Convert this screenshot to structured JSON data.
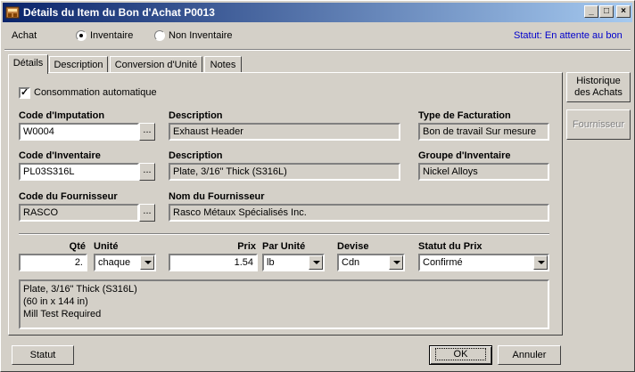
{
  "window": {
    "title": "Détails du Item du Bon d'Achat P0013",
    "minimize_glyph": "_",
    "maximize_glyph": "□",
    "close_glyph": "×"
  },
  "header": {
    "achat_label": "Achat",
    "radio_inventaire": "Inventaire",
    "radio_non_inventaire": "Non Inventaire",
    "selected": "Inventaire",
    "status": "Statut: En attente au bon"
  },
  "tabs": [
    {
      "label": "Détails",
      "active": true
    },
    {
      "label": "Description",
      "active": false
    },
    {
      "label": "Conversion d'Unité",
      "active": false
    },
    {
      "label": "Notes",
      "active": false
    }
  ],
  "details": {
    "auto_consumption_label": "Consommation automatique",
    "auto_consumption_checked": true,
    "code_imputation_label": "Code d'Imputation",
    "code_imputation_value": "W0004",
    "desc1_label": "Description",
    "desc1_value": "Exhaust Header",
    "type_fact_label": "Type de Facturation",
    "type_fact_value": "Bon de travail Sur mesure",
    "code_inventaire_label": "Code d'Inventaire",
    "code_inventaire_value": "PL03S316L",
    "desc2_label": "Description",
    "desc2_value": "Plate, 3/16\" Thick (S316L)",
    "groupe_inv_label": "Groupe d'Inventaire",
    "groupe_inv_value": "Nickel Alloys",
    "code_fourn_label": "Code du Fournisseur",
    "code_fourn_value": "RASCO",
    "nom_fourn_label": "Nom du Fournisseur",
    "nom_fourn_value": "Rasco Métaux Spécialisés Inc.",
    "browse_glyph": "...",
    "qte_label": "Qté",
    "qte_value": "2.",
    "unite_label": "Unité",
    "unite_value": "chaque",
    "prix_label": "Prix",
    "prix_value": "1.54",
    "par_unite_label": "Par Unité",
    "par_unite_value": "lb",
    "devise_label": "Devise",
    "devise_value": "Cdn",
    "statut_prix_label": "Statut du Prix",
    "statut_prix_value": "Confirmé",
    "memo": "Plate, 3/16\" Thick (S316L)\n(60 in x 144 in)\nMill Test Required"
  },
  "side_buttons": {
    "historique": "Historique\ndes Achats",
    "fournisseur": "Fournisseur"
  },
  "footer": {
    "statut": "Statut",
    "ok": "OK",
    "annuler": "Annuler"
  },
  "colors": {
    "title_start": "#0a246a",
    "title_end": "#a6caf0",
    "status_text": "#0000cc",
    "face": "#d4d0c8"
  }
}
